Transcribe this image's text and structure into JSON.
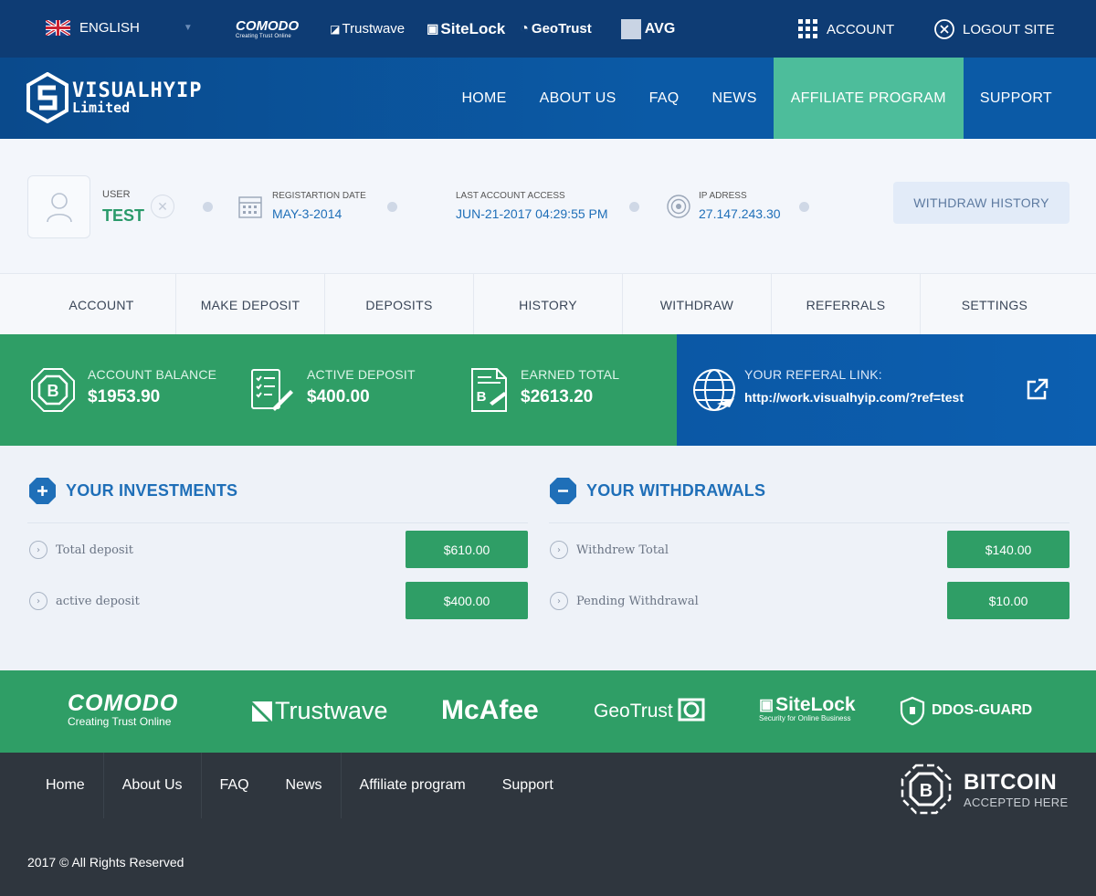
{
  "topbar": {
    "language": "ENGLISH",
    "trust_logos": [
      {
        "name": "COMODO",
        "sub": "Creating Trust Online"
      },
      {
        "name": "Trustwave",
        "sub": ""
      },
      {
        "name": "SiteLock",
        "sub": ""
      },
      {
        "name": "GeoTrust",
        "sub": ""
      },
      {
        "name": "AVG",
        "sub": ""
      }
    ],
    "account_label": "ACCOUNT",
    "logout_label": "LOGOUT SITE"
  },
  "header": {
    "logo_line1": "VISUALHYIP",
    "logo_line2": "Limited",
    "menu": [
      {
        "label": "HOME",
        "active": false
      },
      {
        "label": "ABOUT US",
        "active": false
      },
      {
        "label": "FAQ",
        "active": false
      },
      {
        "label": "NEWS",
        "active": false
      },
      {
        "label": "AFFILIATE PROGRAM",
        "active": true
      },
      {
        "label": "SUPPORT",
        "active": false
      }
    ]
  },
  "user": {
    "user_label": "USER",
    "username": "TEST",
    "reg_label": "REGISTARTION DATE",
    "reg_date": "MAY-3-2014",
    "last_access_label": "LAST ACCOUNT ACCESS",
    "last_access": "JUN-21-2017 04:29:55 PM",
    "ip_label": "IP ADRESS",
    "ip": "27.147.243.30",
    "withdraw_history_label": "WITHDRAW HISTORY"
  },
  "subnav": [
    "ACCOUNT",
    "MAKE DEPOSIT",
    "DEPOSITS",
    "HISTORY",
    "WITHDRAW",
    "REFERRALS",
    "SETTINGS"
  ],
  "stats": {
    "balance_label": "ACCOUNT BALANCE",
    "balance_value": "$1953.90",
    "active_label": "ACTIVE DEPOSIT",
    "active_value": "$400.00",
    "earned_label": "EARNED TOTAL",
    "earned_value": "$2613.20",
    "ref_label": "YOUR REFERAL LINK:",
    "ref_value": "http://work.visualhyip.com/?ref=test"
  },
  "investments": {
    "title": "YOUR INVESTMENTS",
    "rows": [
      {
        "label": "Total deposit",
        "value": "$610.00"
      },
      {
        "label": "active deposit",
        "value": "$400.00"
      }
    ]
  },
  "withdrawals": {
    "title": "YOUR WITHDRAWALS",
    "rows": [
      {
        "label": "Withdrew Total",
        "value": "$140.00"
      },
      {
        "label": "Pending Withdrawal",
        "value": "$10.00"
      }
    ]
  },
  "trust_band": {
    "comodo": "COMODO",
    "comodo_sub": "Creating Trust Online",
    "trustwave": "Trustwave",
    "mcafee": "McAfee",
    "geotrust": "GeoTrust",
    "sitelock": "SiteLock",
    "sitelock_sub": "Security for Online Business",
    "ddos": "DDOS-GUARD"
  },
  "footer": {
    "links": [
      "Home",
      "About Us",
      "FAQ",
      "News",
      "Affiliate program",
      "Support"
    ],
    "copyright": "2017 © All Rights Reserved",
    "bitcoin_title": "BITCOIN",
    "bitcoin_sub": "ACCEPTED HERE"
  },
  "colors": {
    "topbar": "#0e3c74",
    "nav": "#0b5aa6",
    "active_menu": "#4dbd9b",
    "green": "#2f9e66",
    "footer": "#2f363e",
    "accent_blue": "#1f6fb8"
  }
}
